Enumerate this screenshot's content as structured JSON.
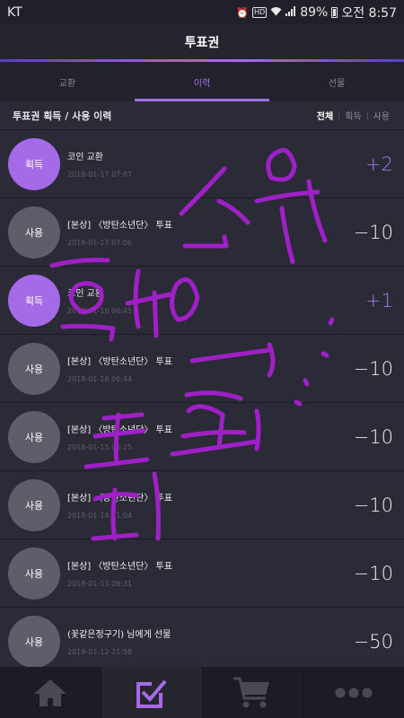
{
  "status_bar": {
    "carrier": "KT",
    "battery": "89%",
    "time": "오전 8:57",
    "hd": "HD"
  },
  "header": {
    "title": "투표권"
  },
  "tabs": [
    {
      "label": "교환",
      "active": false
    },
    {
      "label": "이력",
      "active": true
    },
    {
      "label": "선물",
      "active": false
    }
  ],
  "history": {
    "title": "투표권 획득 / 사용 이력",
    "filters": [
      {
        "label": "전체",
        "active": true
      },
      {
        "label": "획득",
        "active": false
      },
      {
        "label": "사용",
        "active": false
      }
    ],
    "items": [
      {
        "type": "gain",
        "badge": "획득",
        "title": "코인 교환",
        "date": "2018-01-17 07:07",
        "amount": "+2"
      },
      {
        "type": "use",
        "badge": "사용",
        "title": "[본상] 〈방탄소년단〉 투표",
        "date": "2018-01-17 07:06",
        "amount": "−10"
      },
      {
        "type": "gain",
        "badge": "획득",
        "title": "코인 교환",
        "date": "2018-01-16 06:45",
        "amount": "+1"
      },
      {
        "type": "use",
        "badge": "사용",
        "title": "[본상] 〈방탄소년단〉 투표",
        "date": "2018-01-16 06:44",
        "amount": "−10"
      },
      {
        "type": "use",
        "badge": "사용",
        "title": "[본상] 〈방탄소년단〉 투표",
        "date": "2018-01-15 06:25",
        "amount": "−10"
      },
      {
        "type": "use",
        "badge": "사용",
        "title": "[본상] 〈방탄소년단〉 투표",
        "date": "2018-01-14 11:04",
        "amount": "−10"
      },
      {
        "type": "use",
        "badge": "사용",
        "title": "[본상] 〈방탄소년단〉 투표",
        "date": "2018-01-13 09:31",
        "amount": "−10"
      },
      {
        "type": "use",
        "badge": "사용",
        "title": "(꽃같은정구기) 님에게 선물",
        "date": "2018-01-12 21:58",
        "amount": "−50"
      }
    ]
  },
  "bottom_nav": [
    {
      "icon": "home-icon",
      "active": false
    },
    {
      "icon": "vote-check-icon",
      "active": true
    },
    {
      "icon": "cart-icon",
      "active": false
    },
    {
      "icon": "more-icon",
      "active": false
    }
  ],
  "colors": {
    "accent": "#a46ae8",
    "background": "#2b2b37",
    "scribble": "#a020c8"
  }
}
